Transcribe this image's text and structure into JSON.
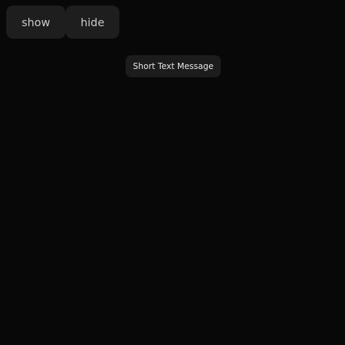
{
  "controls": {
    "show_label": "show",
    "hide_label": "hide"
  },
  "toast": {
    "message": "Short Text Message"
  },
  "colors": {
    "background": "#080808",
    "button_bg": "#1e1e1e",
    "button_text": "#c9c9c9",
    "toast_bg": "#1c1c1c",
    "toast_text": "#e6e6e6"
  }
}
